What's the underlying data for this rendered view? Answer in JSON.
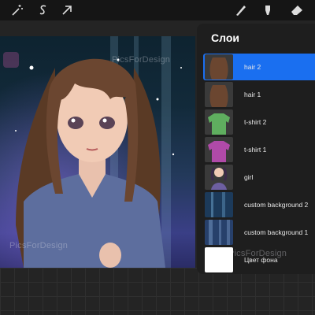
{
  "toolbar": {
    "left_tools": [
      "magic-wand-icon",
      "selection-s-icon",
      "transform-arrow-icon"
    ],
    "right_tools": [
      "brush-icon",
      "smudge-icon",
      "eraser-icon"
    ]
  },
  "layers_panel": {
    "title": "Слои",
    "layers": [
      {
        "name": "hair 2",
        "active": true,
        "thumb": "hair"
      },
      {
        "name": "hair 1",
        "active": false,
        "thumb": "hair"
      },
      {
        "name": "t-shirt 2",
        "active": false,
        "thumb": "green-shirt"
      },
      {
        "name": "t-shirt 1",
        "active": false,
        "thumb": "purple-shirt"
      },
      {
        "name": "girl",
        "active": false,
        "thumb": "girl"
      },
      {
        "name": "custom background 2",
        "active": false,
        "thumb": "bg2"
      },
      {
        "name": "custom background 1",
        "active": false,
        "thumb": "bg1"
      },
      {
        "name": "Цвет фона",
        "active": false,
        "thumb": "white"
      }
    ]
  },
  "watermark": {
    "text": "PicsForDesign"
  },
  "colors": {
    "active_layer": "#1a6ff0",
    "panel": "#1e1e1e",
    "toolbar": "#151515"
  }
}
